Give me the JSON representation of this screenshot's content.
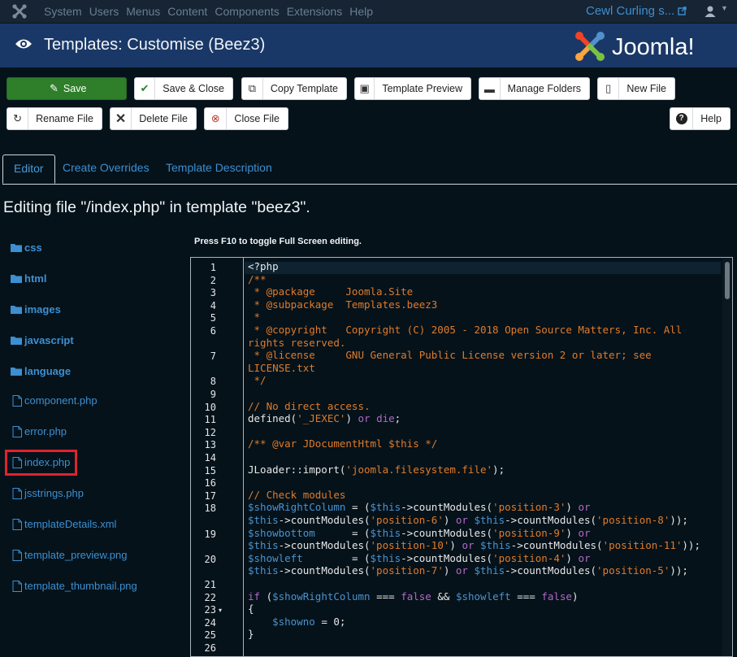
{
  "topbar": {
    "menu": [
      "System",
      "Users",
      "Menus",
      "Content",
      "Components",
      "Extensions",
      "Help"
    ],
    "site_name": "Cewl Curling s...",
    "icons": [
      "joomla-icon",
      "external-link-icon",
      "user-icon",
      "caret-down-icon"
    ]
  },
  "header": {
    "title": "Templates: Customise (Beez3)",
    "brand": "Joomla!"
  },
  "toolbar": {
    "save": "Save",
    "save_close": "Save & Close",
    "copy_template": "Copy Template",
    "template_preview": "Template Preview",
    "manage_folders": "Manage Folders",
    "new_file": "New File",
    "rename_file": "Rename File",
    "delete_file": "Delete File",
    "close_file": "Close File",
    "help": "Help"
  },
  "tabs": [
    "Editor",
    "Create Overrides",
    "Template Description"
  ],
  "editing_label": "Editing file \"/index.php\" in template \"beez3\".",
  "hint": "Press F10 to toggle Full Screen editing.",
  "tree": {
    "folders": [
      "css",
      "html",
      "images",
      "javascript",
      "language"
    ],
    "files": [
      "component.php",
      "error.php",
      "index.php",
      "jsstrings.php",
      "templateDetails.xml",
      "template_preview.png",
      "template_thumbnail.png"
    ],
    "selected": "index.php"
  },
  "editor": {
    "line_numbers": [
      "1",
      "2",
      "3",
      "4",
      "5",
      "6",
      "",
      "7",
      "",
      "8",
      "9",
      "10",
      "11",
      "12",
      "13",
      "14",
      "15",
      "16",
      "17",
      "18",
      "",
      "19",
      "",
      "20",
      "",
      "21",
      "22",
      "23",
      "24",
      "25",
      "26"
    ],
    "fold_marker": "▾",
    "lines": [
      [
        [
          "p",
          "<?php"
        ]
      ],
      [
        [
          "c",
          "/**"
        ]
      ],
      [
        [
          "c",
          " * @package     Joomla.Site"
        ]
      ],
      [
        [
          "c",
          " * @subpackage  Templates.beez3"
        ]
      ],
      [
        [
          "c",
          " *"
        ]
      ],
      [
        [
          "c",
          " * @copyright   Copyright (C) 2005 - 2018 Open Source Matters, Inc. All"
        ]
      ],
      [
        [
          "c",
          "rights reserved."
        ]
      ],
      [
        [
          "c",
          " * @license     GNU General Public License version 2 or later; see"
        ]
      ],
      [
        [
          "c",
          "LICENSE.txt"
        ]
      ],
      [
        [
          "c",
          " */"
        ]
      ],
      [],
      [
        [
          "c",
          "// No direct access."
        ]
      ],
      [
        [
          "p",
          "defined("
        ],
        [
          "s",
          "'_JEXEC'"
        ],
        [
          "p",
          ") "
        ],
        [
          "k",
          "or"
        ],
        [
          "p",
          " "
        ],
        [
          "k",
          "die"
        ],
        [
          "p",
          ";"
        ]
      ],
      [],
      [
        [
          "c",
          "/** @var JDocumentHtml $this */"
        ]
      ],
      [],
      [
        [
          "p",
          "JLoader::import("
        ],
        [
          "s",
          "'joomla.filesystem.file'"
        ],
        [
          "p",
          ");"
        ]
      ],
      [],
      [
        [
          "c",
          "// Check modules"
        ]
      ],
      [
        [
          "v",
          "$showRightColumn"
        ],
        [
          "p",
          " = ("
        ],
        [
          "v",
          "$this"
        ],
        [
          "p",
          "->countModules("
        ],
        [
          "s",
          "'position-3'"
        ],
        [
          "p",
          ") "
        ],
        [
          "k",
          "or"
        ]
      ],
      [
        [
          "v",
          "$this"
        ],
        [
          "p",
          "->countModules("
        ],
        [
          "s",
          "'position-6'"
        ],
        [
          "p",
          ") "
        ],
        [
          "k",
          "or"
        ],
        [
          "p",
          " "
        ],
        [
          "v",
          "$this"
        ],
        [
          "p",
          "->countModules("
        ],
        [
          "s",
          "'position-8'"
        ],
        [
          "p",
          "));"
        ]
      ],
      [
        [
          "v",
          "$showbottom"
        ],
        [
          "p",
          "      = ("
        ],
        [
          "v",
          "$this"
        ],
        [
          "p",
          "->countModules("
        ],
        [
          "s",
          "'position-9'"
        ],
        [
          "p",
          ") "
        ],
        [
          "k",
          "or"
        ]
      ],
      [
        [
          "v",
          "$this"
        ],
        [
          "p",
          "->countModules("
        ],
        [
          "s",
          "'position-10'"
        ],
        [
          "p",
          ") "
        ],
        [
          "k",
          "or"
        ],
        [
          "p",
          " "
        ],
        [
          "v",
          "$this"
        ],
        [
          "p",
          "->countModules("
        ],
        [
          "s",
          "'position-11'"
        ],
        [
          "p",
          "));"
        ]
      ],
      [
        [
          "v",
          "$showleft"
        ],
        [
          "p",
          "        = ("
        ],
        [
          "v",
          "$this"
        ],
        [
          "p",
          "->countModules("
        ],
        [
          "s",
          "'position-4'"
        ],
        [
          "p",
          ") "
        ],
        [
          "k",
          "or"
        ]
      ],
      [
        [
          "v",
          "$this"
        ],
        [
          "p",
          "->countModules("
        ],
        [
          "s",
          "'position-7'"
        ],
        [
          "p",
          ") "
        ],
        [
          "k",
          "or"
        ],
        [
          "p",
          " "
        ],
        [
          "v",
          "$this"
        ],
        [
          "p",
          "->countModules("
        ],
        [
          "s",
          "'position-5'"
        ],
        [
          "p",
          "));"
        ]
      ],
      [],
      [
        [
          "k",
          "if"
        ],
        [
          "p",
          " ("
        ],
        [
          "v",
          "$showRightColumn"
        ],
        [
          "p",
          " === "
        ],
        [
          "k",
          "false"
        ],
        [
          "p",
          " && "
        ],
        [
          "v",
          "$showleft"
        ],
        [
          "p",
          " === "
        ],
        [
          "k",
          "false"
        ],
        [
          "p",
          ")"
        ]
      ],
      [
        [
          "p",
          "{"
        ]
      ],
      [
        [
          "p",
          "    "
        ],
        [
          "v",
          "$showno"
        ],
        [
          "p",
          " = 0;"
        ]
      ],
      [
        [
          "p",
          "}"
        ]
      ],
      []
    ]
  },
  "colors": {
    "background": "#05121a",
    "topbar": "#162433",
    "header": "#1a3867",
    "link": "#3d8fd1",
    "save_button": "#2e7e2a",
    "selection_box": "#e0232e",
    "comment": "#e07b2a",
    "keyword": "#b467c7",
    "variable": "#4a93d0"
  }
}
